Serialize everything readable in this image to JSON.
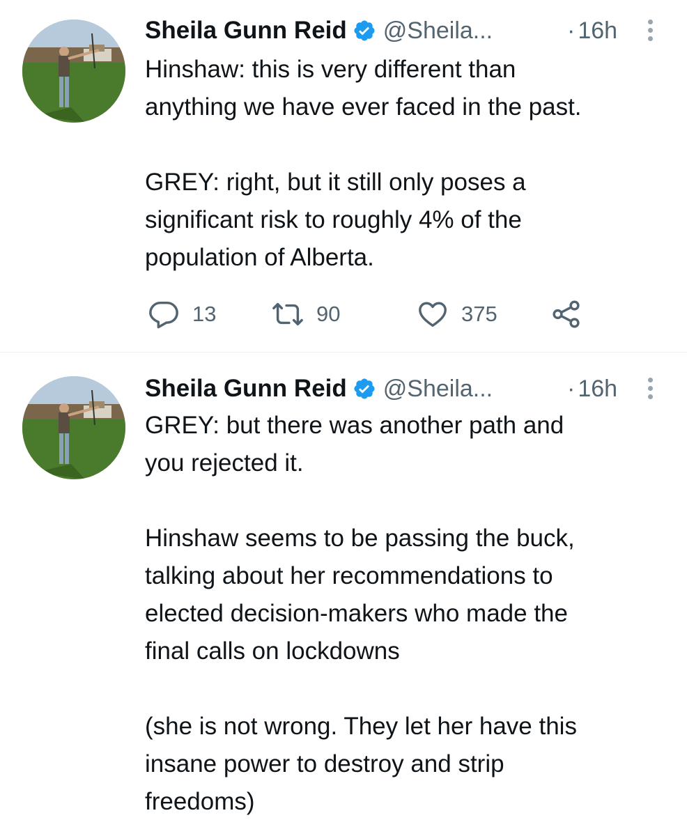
{
  "tweets": [
    {
      "author_name": "Sheila Gunn Reid",
      "handle": "@Sheila...",
      "time": "16h",
      "time_separator": "·",
      "text": "Hinshaw: this is very different than\nanything we have ever faced in the past.\n\nGREY: right, but it still only poses a\nsignificant risk to roughly 4% of the\npopulation of Alberta.",
      "replies": "13",
      "retweets": "90",
      "likes": "375"
    },
    {
      "author_name": "Sheila Gunn Reid",
      "handle": "@Sheila...",
      "time": "16h",
      "time_separator": "·",
      "text": "GREY: but there was another path and\nyou rejected it.\n\nHinshaw seems to be passing the buck,\ntalking about her recommendations to\nelected decision-makers who made the\nfinal calls on lockdowns\n\n(she is not wrong. They let her have this\ninsane power to destroy and strip\nfreedoms)"
    }
  ],
  "icons": {
    "reply": "reply-icon",
    "retweet": "retweet-icon",
    "like": "heart-icon",
    "share": "share-icon",
    "verified": "verified-badge-icon",
    "more": "more-options-icon"
  },
  "colors": {
    "text": "#0f1419",
    "secondary": "#536471",
    "verified": "#1d9bf0",
    "divider": "#eff3f4"
  }
}
